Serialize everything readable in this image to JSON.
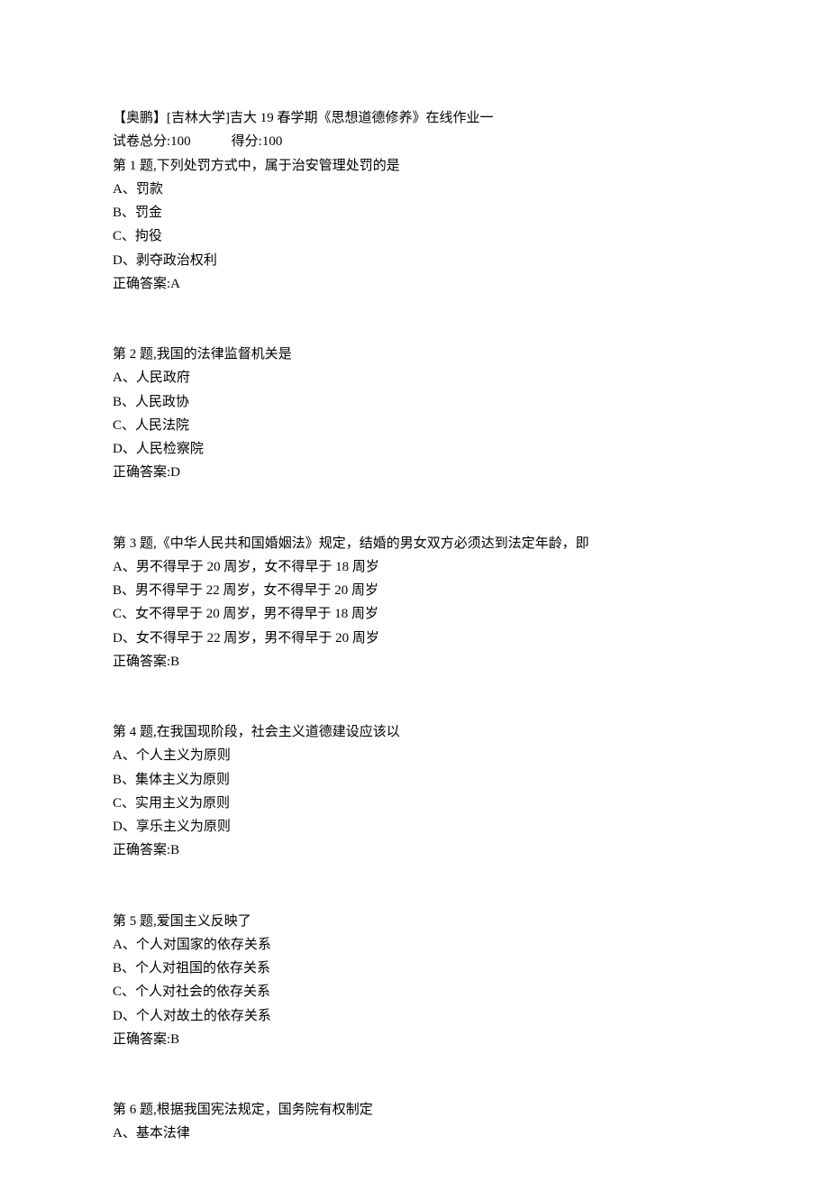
{
  "header": {
    "title": "【奥鹏】[吉林大学]吉大 19 春学期《思想道德修养》在线作业一",
    "total_label": "试卷总分:",
    "total_value": "100",
    "score_label": "得分:",
    "score_value": "100"
  },
  "questions": [
    {
      "stem": "第 1 题,下列处罚方式中，属于治安管理处罚的是",
      "options": [
        "A、罚款",
        "B、罚金",
        "C、拘役",
        "D、剥夺政治权利"
      ],
      "answer": "正确答案:A"
    },
    {
      "stem": "第 2 题,我国的法律监督机关是",
      "options": [
        "A、人民政府",
        "B、人民政协",
        "C、人民法院",
        "D、人民检察院"
      ],
      "answer": "正确答案:D"
    },
    {
      "stem": "第 3 题,《中华人民共和国婚姻法》规定，结婚的男女双方必须达到法定年龄，即",
      "options": [
        "A、男不得早于 20 周岁，女不得早于 18 周岁",
        "B、男不得早于 22 周岁，女不得早于 20 周岁",
        "C、女不得早于 20 周岁，男不得早于 18 周岁",
        "D、女不得早于 22 周岁，男不得早于 20 周岁"
      ],
      "answer": "正确答案:B"
    },
    {
      "stem": "第 4 题,在我国现阶段，社会主义道德建设应该以",
      "options": [
        "A、个人主义为原则",
        "B、集体主义为原则",
        "C、实用主义为原则",
        "D、享乐主义为原则"
      ],
      "answer": "正确答案:B"
    },
    {
      "stem": "第 5 题,爱国主义反映了",
      "options": [
        "A、个人对国家的依存关系",
        "B、个人对祖国的依存关系",
        "C、个人对社会的依存关系",
        "D、个人对故土的依存关系"
      ],
      "answer": "正确答案:B"
    },
    {
      "stem": "第 6 题,根据我国宪法规定，国务院有权制定",
      "options": [
        "A、基本法律"
      ],
      "answer": ""
    }
  ]
}
